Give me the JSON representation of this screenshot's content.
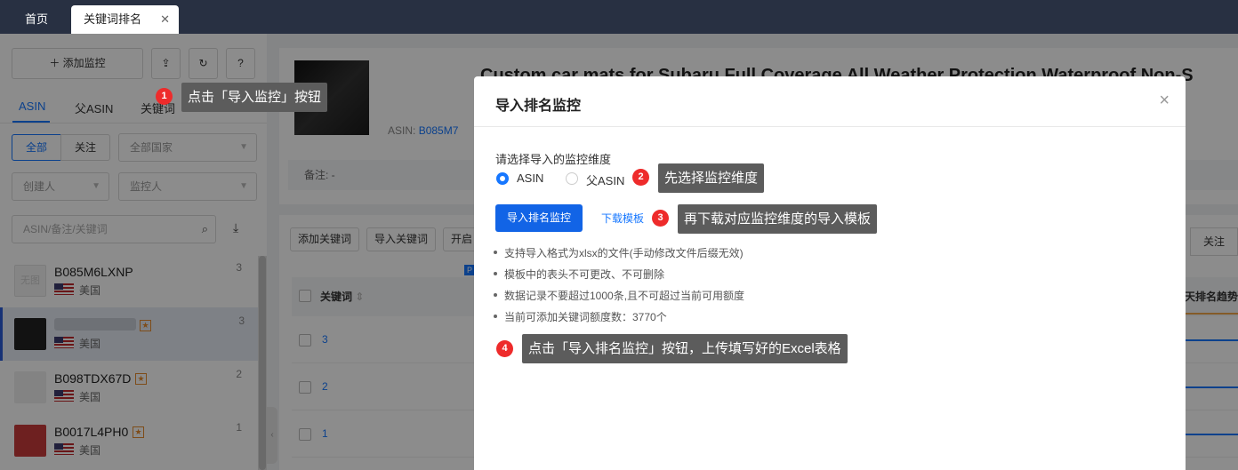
{
  "tabs": {
    "home": "首页",
    "active": "关键词排名"
  },
  "left_panel": {
    "add_monitor": "添加监控",
    "tabs": [
      "ASIN",
      "父ASIN",
      "关键词"
    ],
    "filter_all": "全部",
    "filter_follow": "关注",
    "country_select": "全部国家",
    "creator_select": "创建人",
    "monitor_select": "监控人",
    "search_placeholder": "ASIN/备注/关键词",
    "items": [
      {
        "asin": "B085M6LXNP",
        "country": "美国",
        "count": "3",
        "thumb": "无图"
      },
      {
        "asin": "",
        "country": "美国",
        "count": "3"
      },
      {
        "asin": "B098TDX67D",
        "country": "美国",
        "count": "2"
      },
      {
        "asin": "B0017L4PH0",
        "country": "美国",
        "count": "1"
      }
    ]
  },
  "product": {
    "title": "Custom car mats for Subaru Full Coverage All Weather Protection Waterproof Non-S",
    "asin_label": "ASIN:",
    "asin_value": "B085M7",
    "note": "备注: -"
  },
  "keywords_table": {
    "buttons": [
      "添加关键词",
      "导入关键词",
      "开启"
    ],
    "follow": "关注",
    "badge": "P",
    "col_keyword": "关键词",
    "col_trend": "天排名趋势",
    "rows": [
      "3",
      "2",
      "1"
    ]
  },
  "modal": {
    "title": "导入排名监控",
    "close": "×",
    "dimension_label": "请选择导入的监控维度",
    "options": [
      "ASIN",
      "父ASIN"
    ],
    "selected_option": "ASIN",
    "import_button": "导入排名监控",
    "template_link": "下载模板",
    "notes": [
      "支持导入格式为xlsx的文件(手动修改文件后缀无效)",
      "模板中的表头不可更改、不可删除",
      "数据记录不要超过1000条,且不可超过当前可用额度",
      "当前可添加关键词额度数：3770个"
    ]
  },
  "annotations": [
    {
      "num": "1",
      "text": "点击「导入监控」按钮"
    },
    {
      "num": "2",
      "text": "先选择监控维度"
    },
    {
      "num": "3",
      "text": "再下载对应监控维度的导入模板"
    },
    {
      "num": "4",
      "text": "点击「导入排名监控」按钮，上传填写好的Excel表格"
    }
  ],
  "colors": {
    "topbar": "#283042",
    "primary": "#1264e6",
    "badge": "#ee2b2b",
    "tip": "#5c5c5c"
  }
}
